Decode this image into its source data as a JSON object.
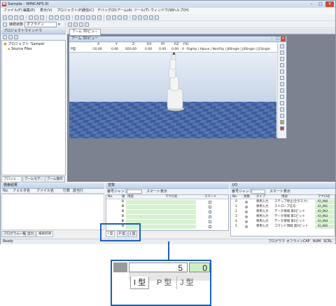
{
  "window": {
    "title": "Sample - WINCAPS III",
    "logo": "W",
    "controls": [
      "–",
      "□",
      "×"
    ]
  },
  "menu": [
    "ファイル(F)",
    "編集(E)",
    "表示(V)",
    "プロジェクト(P)",
    "通信(C)",
    "デバッグ(D)",
    "アーム(A)",
    "ツール(T)",
    "ウィンドウ(W)",
    "ヘルプ(H)"
  ],
  "toolbar": {
    "connection_label": "接続状態",
    "connection_value": "オフライン"
  },
  "project_panel": {
    "title": "プロジェクトウインドウ",
    "tree_root": "プロジェクト 'Sample'",
    "tree_child": "Source Files",
    "tabs": [
      "プロジェ...",
      "アームモデ...",
      "アーム操作"
    ]
  },
  "arm_view": {
    "title": "アーム 3Dビュー",
    "headers": [
      "",
      "X",
      "Y",
      "Z",
      "RX",
      "RY",
      "RZ",
      "FIG"
    ],
    "row_label": "P型",
    "values": [
      "-10.00",
      "0.00",
      "920.00",
      "0.00",
      "0.00",
      "0.00",
      "4 - Righty | Above | NonFlip | J6Single | J4Single | J1Single"
    ],
    "floor_color": "#3d5e9e",
    "sky_color": "#e8eef7"
  },
  "output_panel": {
    "title": "検索結果",
    "columns": [
      "No.",
      "フォルダ名",
      "ファイル名",
      "行数",
      "該当行"
    ],
    "tabs": [
      "プログラム一覧",
      "出力",
      "検索結果"
    ]
  },
  "variable_panel": {
    "title": "変数",
    "jump_label": "番号ジャンプ",
    "smart_label": "スマート表示",
    "columns": [
      "No.",
      "値",
      "用途",
      "マクロ名",
      "スマート"
    ],
    "rows": [
      {
        "no": "0",
        "value": "0"
      },
      {
        "no": "1",
        "value": "0"
      },
      {
        "no": "2",
        "value": "0"
      },
      {
        "no": "3",
        "value": "0"
      },
      {
        "no": "4",
        "value": "0"
      },
      {
        "no": "5",
        "value": "0"
      }
    ],
    "type_tabs": [
      "I 型",
      "P 型",
      "J 型"
    ]
  },
  "io_panel": {
    "title": "I/O",
    "jump_label": "番号ジャンプ",
    "smart_label": "スマート表示",
    "columns": [
      "No.",
      "状態",
      "タイプ",
      "用途",
      "マクロ名"
    ],
    "rows": [
      {
        "no": "0",
        "type": "専用入力",
        "use": "ステップ停止(全タスク)",
        "macro": "IO_IN0"
      },
      {
        "no": "1",
        "type": "専用入力",
        "use": "ストローブ信号",
        "macro": "IO_IN1"
      },
      {
        "no": "2",
        "type": "専用入力",
        "use": "データ領域 第0ビット",
        "macro": "IO_IN2"
      },
      {
        "no": "3",
        "type": "専用入力",
        "use": "データ領域 第1ビット",
        "macro": "IO_IN3"
      },
      {
        "no": "4",
        "type": "専用入力",
        "use": "データ領域 第2ビット",
        "macro": "IO_IN4"
      },
      {
        "no": "5",
        "type": "専用入力",
        "use": "コマンド領域 第0ビット",
        "macro": "IO_IN5"
      }
    ]
  },
  "statusbar": {
    "left": "Ready",
    "mode": "プログラマ",
    "state": "オフライン",
    "caps": "CAP",
    "num": "NUM",
    "scrl": "SCRL"
  },
  "zoom": {
    "cell_value": "5",
    "green_value": "0",
    "tabs": [
      "I 型",
      "P 型",
      "J 型"
    ]
  }
}
